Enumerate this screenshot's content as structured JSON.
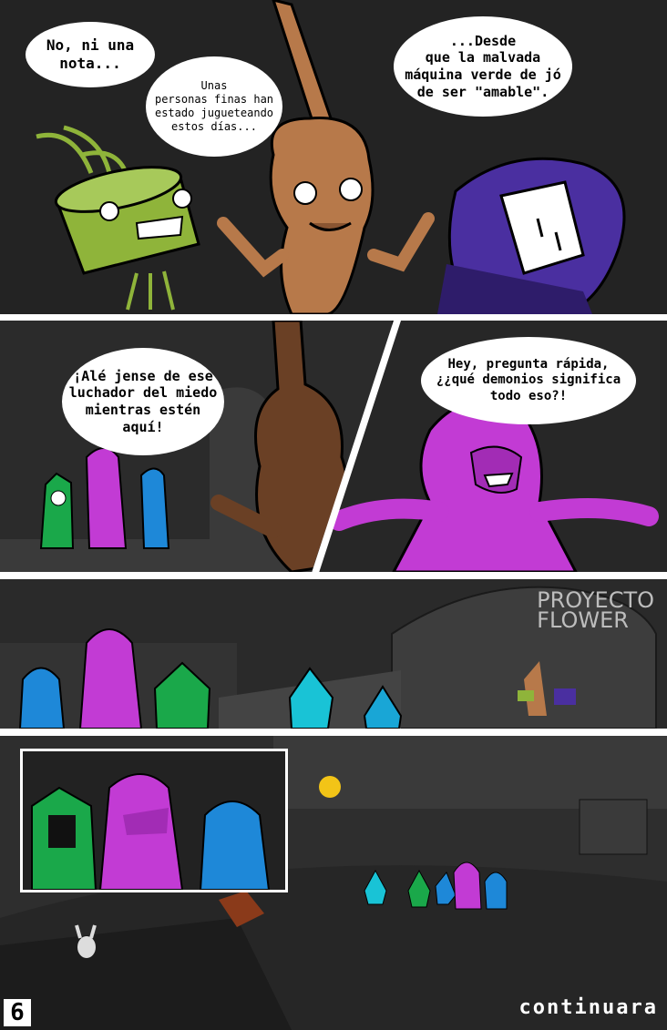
{
  "page_number": "6",
  "ending_label": "continuara",
  "watermark": {
    "line1": "PROYECTO",
    "line2": "FLOWER"
  },
  "panel1": {
    "bubble_drum": "No, ni una\nnota...",
    "bubble_violin": "Unas\npersonas finas han\nestado jugueteando\nestos días...",
    "bubble_piano": "...Desde\nque la malvada\nmáquina verde de jó\nde ser \"amable\"."
  },
  "panel2": {
    "bubble_violin": "¡Alé jense de ese\nluchador del miedo\nmientras estén\naquí!"
  },
  "panel3": {
    "bubble_susie": "Hey, pregunta rápida,\n¿¿qué demonios significa\ntodo eso?!"
  },
  "colors": {
    "kris": "#1e88d8",
    "susie": "#c23bd4",
    "ralsei": "#1aa84a",
    "lancer": "#19c3d6",
    "violin": "#b7794a",
    "drum": "#8fb43a",
    "piano": "#4a2fa0"
  }
}
